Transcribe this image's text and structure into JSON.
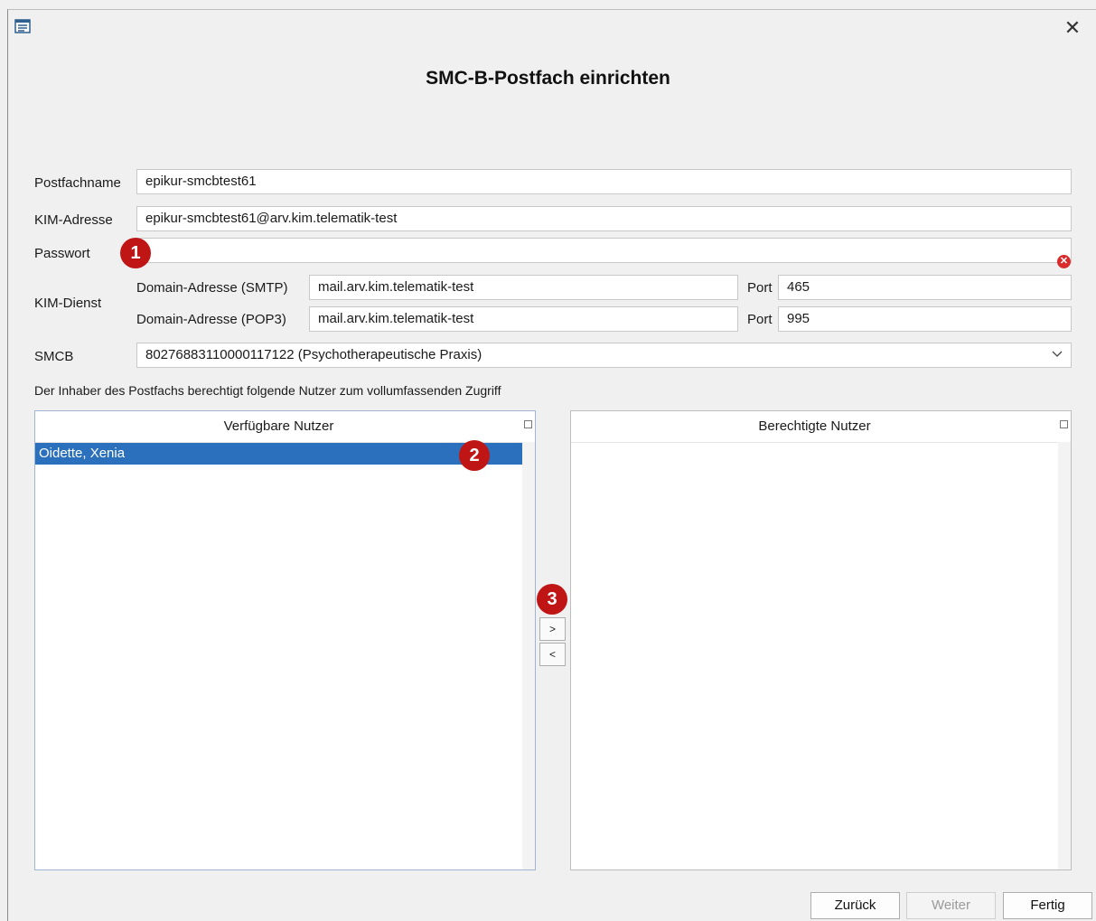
{
  "window": {
    "title": "SMC-B-Postfach einrichten",
    "icon": "app-window-icon",
    "close_icon": "close-icon"
  },
  "form": {
    "postfachname_label": "Postfachname",
    "postfachname_value": "epikur-smcbtest61",
    "kim_adresse_label": "KIM-Adresse",
    "kim_adresse_value": "epikur-smcbtest61@arv.kim.telematik-test",
    "passwort_label": "Passwort",
    "passwort_value": "",
    "kim_dienst_label": "KIM-Dienst",
    "smtp_label": "Domain-Adresse (SMTP)",
    "smtp_value": "mail.arv.kim.telematik-test",
    "smtp_port_label": "Port",
    "smtp_port_value": "465",
    "pop3_label": "Domain-Adresse (POP3)",
    "pop3_value": "mail.arv.kim.telematik-test",
    "pop3_port_label": "Port",
    "pop3_port_value": "995",
    "smcb_label": "SMCB",
    "smcb_value": "80276883110000117122 (Psychotherapeutische Praxis)",
    "permission_text": "Der Inhaber des Postfachs berechtigt folgende Nutzer zum vollumfassenden Zugriff"
  },
  "available_users": {
    "header": "Verfügbare Nutzer",
    "items": [
      "Oidette, Xenia"
    ]
  },
  "authorized_users": {
    "header": "Berechtigte Nutzer",
    "items": []
  },
  "move_buttons": {
    "add": ">",
    "remove": "<"
  },
  "annotations": {
    "badge1": "1",
    "badge2": "2",
    "badge3": "3"
  },
  "footer": {
    "back": "Zurück",
    "next": "Weiter",
    "finish": "Fertig"
  },
  "colors": {
    "selection": "#2b70bd",
    "badge": "#c01515",
    "error": "#d92b2b"
  }
}
